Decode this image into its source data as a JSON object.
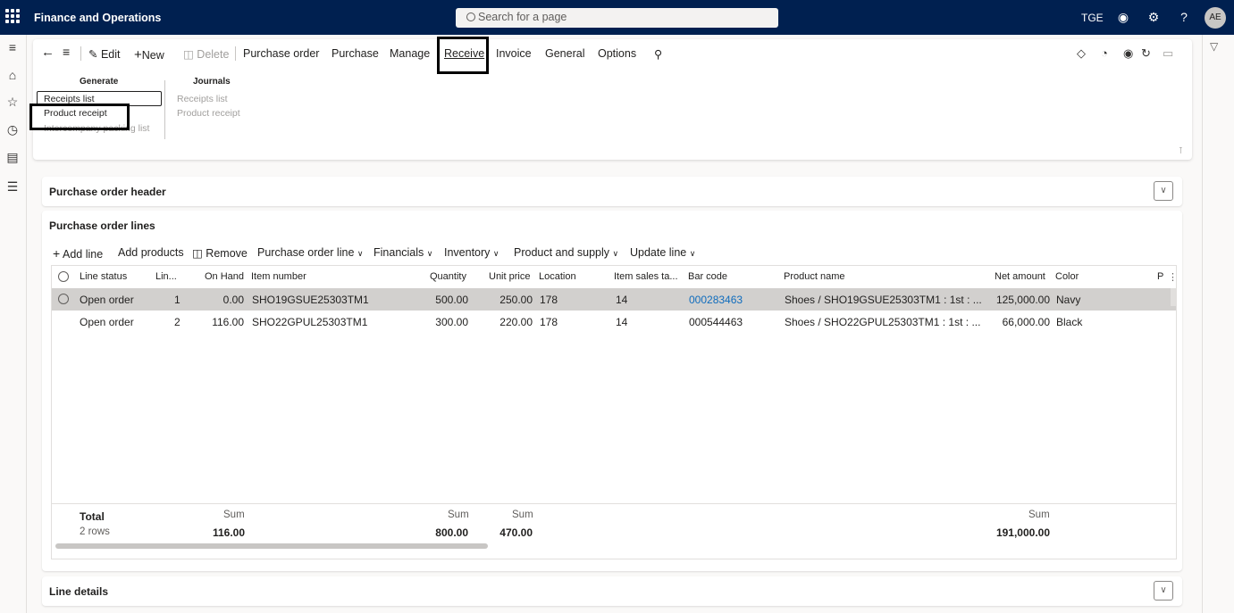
{
  "topbar": {
    "app_title": "Finance and Operations",
    "search_placeholder": "Search for a page",
    "company": "TGE",
    "help": "?",
    "avatar_initials": "AE",
    "icons": [
      "waffle-icon",
      "chat-icon",
      "settings-icon",
      "help-icon"
    ]
  },
  "leftnav": {
    "icons": [
      "hamburger-icon",
      "home-icon",
      "star-icon",
      "clock-icon",
      "workspace-icon",
      "list-icon"
    ]
  },
  "action_pane": {
    "edit": "Edit",
    "new": "New",
    "delete": "Delete",
    "tabs": [
      "Purchase order",
      "Purchase",
      "Manage",
      "Receive",
      "Invoice",
      "General",
      "Options"
    ],
    "active_tab": "Receive",
    "groups": {
      "generate": {
        "title": "Generate",
        "items": [
          "Receipts list",
          "Product receipt",
          "Intercompany packing list"
        ]
      },
      "journals": {
        "title": "Journals",
        "items": [
          "Receipts list",
          "Product receipt"
        ]
      }
    }
  },
  "header_panel": {
    "title": "Purchase order header"
  },
  "lines_panel": {
    "title": "Purchase order lines",
    "toolbar": [
      "Add line",
      "Add products",
      "Remove",
      "Purchase order line",
      "Financials",
      "Inventory",
      "Product and supply",
      "Update line"
    ],
    "columns": [
      "Line status",
      "Lin...",
      "On Hand",
      "Item number",
      "Quantity",
      "Unit price",
      "Location",
      "Item sales ta...",
      "Bar code",
      "Product name",
      "Net amount",
      "Color",
      "P"
    ],
    "rows": [
      {
        "status": "Open order",
        "line": "1",
        "on_hand": "0.00",
        "item": "SHO19GSUE25303TM1",
        "qty": "500.00",
        "price": "250.00",
        "loc": "178",
        "tax": "14",
        "barcode": "000283463",
        "product": "Shoes / SHO19GSUE25303TM1 : 1st : ...",
        "net": "125,000.00",
        "color": "Navy"
      },
      {
        "status": "Open order",
        "line": "2",
        "on_hand": "116.00",
        "item": "SHO22GPUL25303TM1",
        "qty": "300.00",
        "price": "220.00",
        "loc": "178",
        "tax": "14",
        "barcode": "000544463",
        "product": "Shoes / SHO22GPUL25303TM1 : 1st : ...",
        "net": "66,000.00",
        "color": "Black"
      }
    ],
    "footer": {
      "total_label": "Total",
      "rows_label": "2 rows",
      "sum_label": "Sum",
      "on_hand_sum": "116.00",
      "qty_sum": "800.00",
      "price_sum": "470.00",
      "net_sum": "191,000.00"
    }
  },
  "line_details_panel": {
    "title": "Line details"
  }
}
